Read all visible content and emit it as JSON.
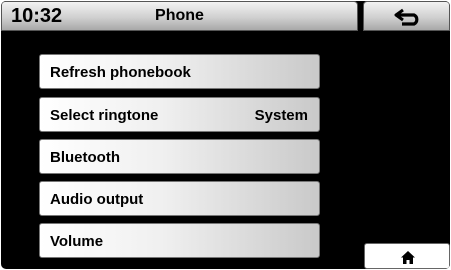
{
  "header": {
    "time": "10:32",
    "title": "Phone",
    "back_icon": "back-arrow-icon"
  },
  "menu": {
    "items": [
      {
        "label": "Refresh phonebook",
        "value": ""
      },
      {
        "label": "Select ringtone",
        "value": "System"
      },
      {
        "label": "Bluetooth",
        "value": ""
      },
      {
        "label": "Audio output",
        "value": ""
      },
      {
        "label": "Volume",
        "value": ""
      }
    ]
  },
  "footer": {
    "home_icon": "home-icon"
  },
  "colors": {
    "background": "#000000",
    "button_face": "#efefef",
    "text": "#000000"
  }
}
